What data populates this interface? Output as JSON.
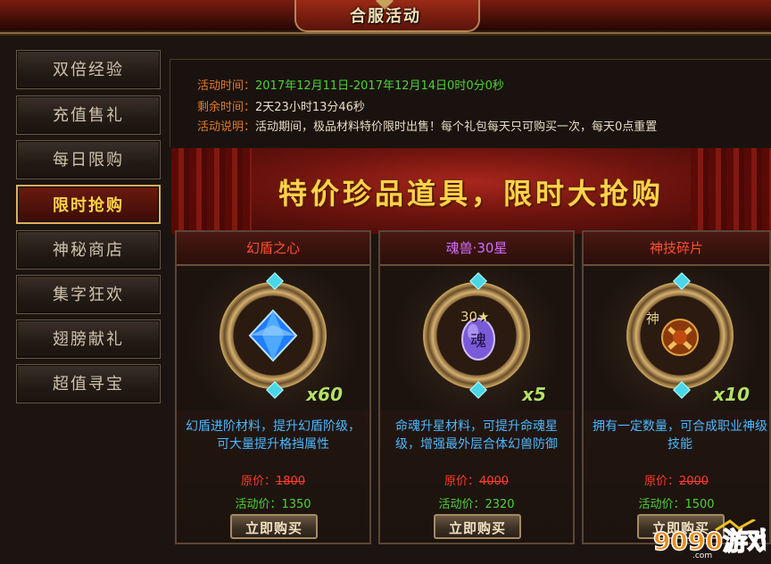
{
  "window": {
    "title": "合服活动"
  },
  "sidebar": {
    "items": [
      {
        "label": "双倍经验",
        "active": false
      },
      {
        "label": "充值售礼",
        "active": false
      },
      {
        "label": "每日限购",
        "active": false
      },
      {
        "label": "限时抢购",
        "active": true
      },
      {
        "label": "神秘商店",
        "active": false
      },
      {
        "label": "集字狂欢",
        "active": false
      },
      {
        "label": "翅膀献礼",
        "active": false
      },
      {
        "label": "超值寻宝",
        "active": false
      }
    ]
  },
  "info": {
    "time_label": "活动时间：",
    "time_value": "2017年12月11日-2017年12月14日0时0分0秒",
    "remain_label": "剩余时间：",
    "remain_value": "2天23小时13分46秒",
    "desc_label": "活动说明：",
    "desc_value": "活动期间，极品材料特价限时出售！每个礼包每天只可购买一次，每天0点重置"
  },
  "banner": {
    "text": "特价珍品道具，限时大抢购"
  },
  "cards": [
    {
      "name": "幻盾之心",
      "qty": "x60",
      "desc": "幻盾进阶材料，提升幻盾阶级，可大量提升格挡属性",
      "old_price_label": "原价：",
      "old_price": "1800",
      "new_price_label": "活动价：",
      "new_price": "1350",
      "buy_label": "立即购买"
    },
    {
      "name": "魂兽·30星",
      "qty": "x5",
      "corner": "30★",
      "desc": "命魂升星材料，可提升命魂星级，增强最外层合体幻兽防御",
      "old_price_label": "原价：",
      "old_price": "4000",
      "new_price_label": "活动价：",
      "new_price": "2320",
      "buy_label": "立即购买"
    },
    {
      "name": "神技碎片",
      "qty": "x10",
      "corner": "神",
      "desc": "拥有一定数量，可合成职业神级技能",
      "old_price_label": "原价：",
      "old_price": "2000",
      "new_price_label": "活动价：",
      "new_price": "1500",
      "buy_label": "立即购买"
    }
  ],
  "watermark": {
    "brand": "9090游戏",
    "domain": ".com"
  },
  "colors": {
    "accent_gold": "#ffd24a",
    "label_orange": "#e07a2a",
    "value_green": "#4fd03a",
    "desc_blue": "#4ab8ff",
    "price_red": "#ff3a2a"
  }
}
